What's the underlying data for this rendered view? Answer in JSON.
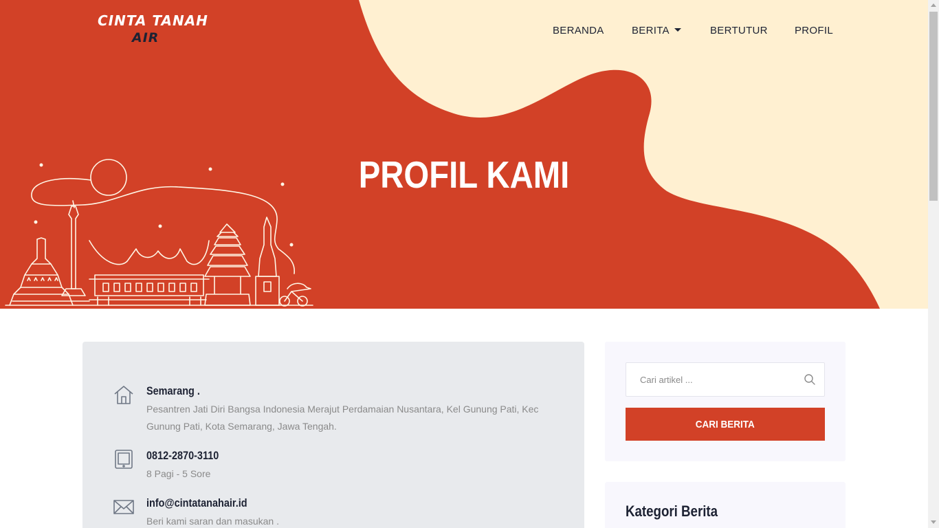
{
  "brand": {
    "line1": "CINTA TANAH",
    "line2": "AIR"
  },
  "nav": {
    "items": [
      {
        "label": "BERANDA"
      },
      {
        "label": "BERITA",
        "dropdown": true
      },
      {
        "label": "BERTUTUR"
      },
      {
        "label": "PROFIL"
      }
    ]
  },
  "hero": {
    "title": "PROFIL KAMI"
  },
  "contact": {
    "items": [
      {
        "icon": "home-icon",
        "title": "Semarang .",
        "text": "Pesantren Jati Diri Bangsa Indonesia Merajut Perdamaian Nusantara, Kel Gunung Pati, Kec Gunung Pati, Kota Semarang, Jawa Tengah."
      },
      {
        "icon": "tablet-icon",
        "title": "0812-2870-3110",
        "text": "8 Pagi - 5 Sore"
      },
      {
        "icon": "mail-icon",
        "title": "info@cintatanahair.id",
        "text": "Beri kami saran dan masukan ."
      }
    ]
  },
  "sidebar": {
    "search": {
      "placeholder": "Cari artikel ...",
      "button_label": "CARI BERITA"
    },
    "categories": {
      "title": "Kategori Berita"
    }
  },
  "colors": {
    "primary": "#d24127",
    "cream": "#fff0d1",
    "dark": "#1d2233",
    "muted": "#8a8a8a",
    "card": "#e8eaed"
  }
}
